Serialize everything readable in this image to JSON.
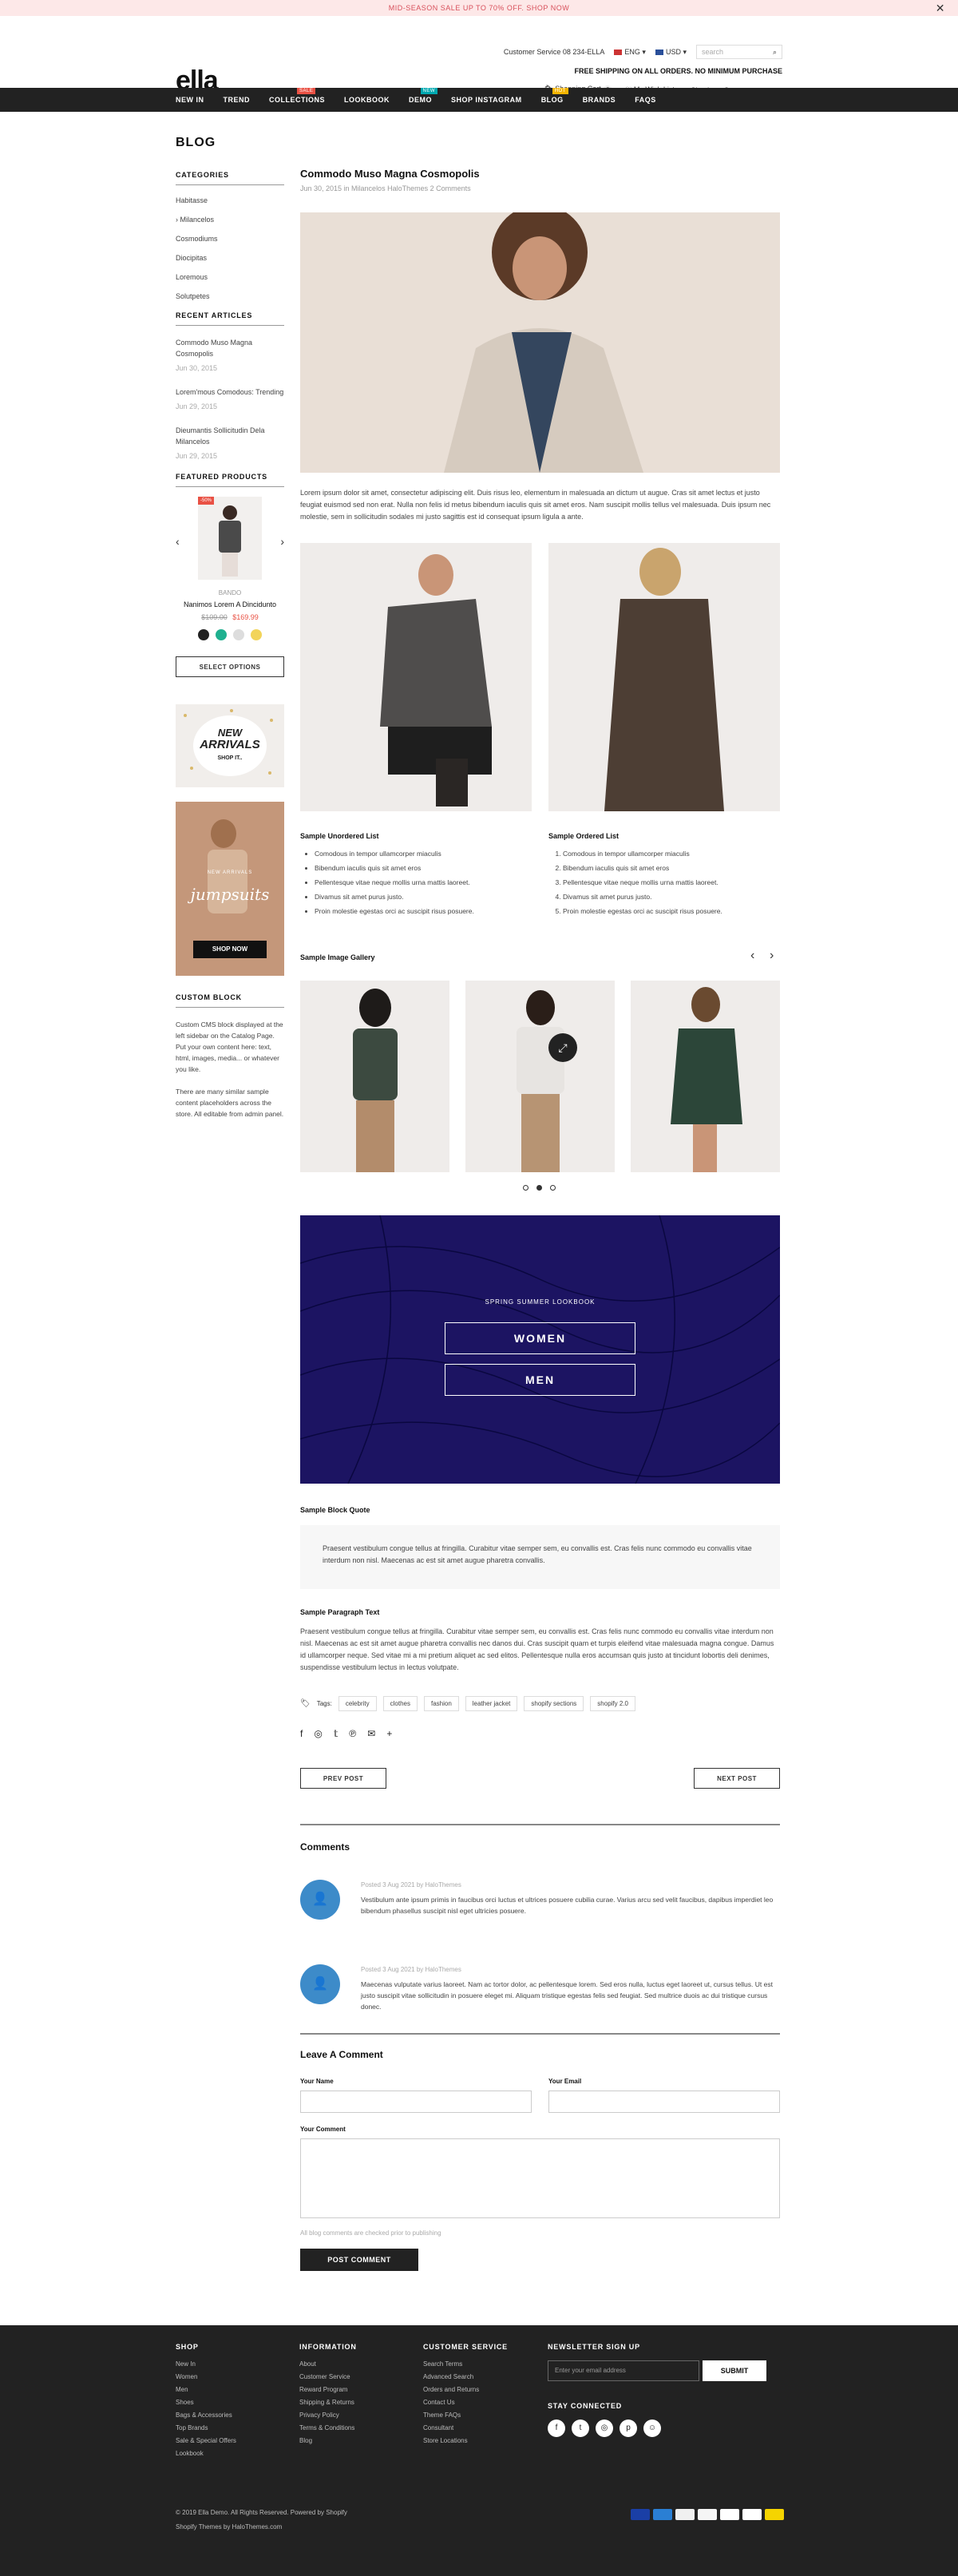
{
  "promo": {
    "text": "MID-SEASON SALE UP TO 70% OFF. SHOP NOW"
  },
  "header": {
    "logo": "ella",
    "customer_service": "Customer Service 08 234-ELLA",
    "lang": "ENG",
    "currency": "USD",
    "search_placeholder": "search",
    "shipping": "FREE SHIPPING ON ALL ORDERS. NO MINIMUM PURCHASE",
    "cart": "Shopping Cart",
    "cart_count": "0",
    "wishlist": "My Wish Lists",
    "signin": "Sign In or Create an account"
  },
  "nav": [
    {
      "label": "NEW IN"
    },
    {
      "label": "TREND"
    },
    {
      "label": "COLLECTIONS",
      "badge": "SALE",
      "color": "#e95144"
    },
    {
      "label": "LOOKBOOK"
    },
    {
      "label": "DEMO",
      "badge": "NEW",
      "color": "#00a8b0"
    },
    {
      "label": "SHOP INSTAGRAM"
    },
    {
      "label": "BLOG",
      "badge": "HOT",
      "color": "#f4b400"
    },
    {
      "label": "BRANDS"
    },
    {
      "label": "FAQS"
    }
  ],
  "sidebar": {
    "heading": "BLOG",
    "categories_title": "CATEGORIES",
    "categories": [
      "Habitasse",
      "Milancelos",
      "Cosmodiums",
      "Diocipitas",
      "Loremous",
      "Solutpetes"
    ],
    "recent_title": "RECENT ARTICLES",
    "recent": [
      {
        "title": "Commodo Muso Magna Cosmopolis",
        "date": "Jun 30, 2015"
      },
      {
        "title": "Lorem'mous Comodous: Trending",
        "date": "Jun 29, 2015"
      },
      {
        "title": "Dieumantis Sollicitudin Dela Milancelos",
        "date": "Jun 29, 2015"
      }
    ],
    "featured_title": "FEATURED PRODUCTS",
    "product": {
      "badge": "-50%",
      "vendor": "BANDO",
      "name": "Nanimos Lorem A Dincidunto",
      "old_price": "$109.00",
      "price": "$169.99",
      "swatches": [
        "#222222",
        "#1fb08f",
        "#dddddd",
        "#f2d45a"
      ],
      "button": "SELECT OPTIONS"
    },
    "banner1": {
      "line1": "NEW",
      "line2": "ARRIVALS",
      "line3": "SHOP IT.."
    },
    "banner2": {
      "small": "NEW ARRIVALS",
      "script": "jumpsuits",
      "button": "SHOP NOW"
    },
    "custom_title": "CUSTOM BLOCK",
    "custom_p1": "Custom CMS block displayed at the left sidebar on the Catalog Page. Put your own content here: text, html, images, media... or whatever you like.",
    "custom_p2": "There are many similar sample content placeholders across the store. All editable from admin panel."
  },
  "post": {
    "title": "Commodo Muso Magna Cosmopolis",
    "meta": "Jun 30, 2015 in Milancelos   HaloThemes   2 Comments",
    "intro": "Lorem ipsum dolor sit amet, consectetur adipiscing elit. Duis risus leo, elementum in malesuada an dictum ut augue. Cras sit amet lectus et justo feugiat euismod sed non erat. Nulla non felis id metus bibendum iaculis quis sit amet eros. Nam suscipit mollis tellus vel malesuada. Duis ipsum nec molestie, sem in sollicitudin sodales mi justo sagittis est id consequat ipsum ligula a ante.",
    "ul_title": "Sample Unordered List",
    "ul": [
      "Comodous in tempor ullamcorper miaculis",
      "Bibendum iaculis quis sit amet eros",
      "Pellentesque vitae neque mollis urna mattis laoreet.",
      "Divamus sit amet purus justo.",
      "Proin molestie egestas orci ac suscipit risus posuere."
    ],
    "ol_title": "Sample Ordered List",
    "ol": [
      "Comodous in tempor ullamcorper miaculis",
      "Bibendum iaculis quis sit amet eros",
      "Pellentesque vitae neque mollis urna mattis laoreet.",
      "Divamus sit amet purus justo.",
      "Proin molestie egestas orci ac suscipit risus posuere."
    ],
    "gallery_title": "Sample Image Gallery",
    "lookbook_small": "SPRING SUMMER LOOKBOOK",
    "lookbook_women": "WOMEN",
    "lookbook_men": "MEN",
    "quote_title": "Sample Block Quote",
    "quote": "Praesent vestibulum congue tellus at fringilla. Curabitur vitae semper sem, eu convallis est. Cras felis nunc commodo eu convallis vitae interdum non nisl. Maecenas ac est sit amet augue pharetra convallis.",
    "ptext_title": "Sample Paragraph Text",
    "ptext": "Praesent vestibulum congue tellus at fringilla. Curabitur vitae semper sem, eu convallis est. Cras felis nunc commodo eu convallis vitae interdum non nisl. Maecenas ac est sit amet augue pharetra convallis nec danos dui. Cras suscipit quam et turpis eleifend vitae malesuada magna congue. Damus id ullamcorper neque. Sed vitae mi a mi pretium aliquet ac sed elitos. Pellentesque nulla eros accumsan quis justo at tincidunt lobortis deli denimes, suspendisse vestibulum lectus in lectus volutpate.",
    "tags_label": "Tags:",
    "tags": [
      "celebrity",
      "clothes",
      "fashion",
      "leather jacket",
      "shopify sections",
      "shopify 2.0"
    ],
    "prev": "PREV POST",
    "next": "NEXT POST"
  },
  "comments": {
    "title": "Comments",
    "items": [
      {
        "meta": "Posted 3 Aug 2021 by HaloThemes",
        "text": "Vestibulum ante ipsum primis in faucibus orci luctus et ultrices posuere cubilia curae. Varius arcu sed velit faucibus, dapibus imperdiet leo bibendum phasellus suscipit nisl eget ultricies posuere."
      },
      {
        "meta": "Posted 3 Aug 2021 by HaloThemes",
        "text": "Maecenas vulputate varius laoreet. Nam ac tortor dolor, ac pellentesque lorem. Sed eros nulla, luctus eget laoreet ut, cursus tellus. Ut est justo suscipit vitae sollicitudin in posuere eleget mi. Aliquam tristique egestas felis sed feugiat. Sed multrice duois ac dui tristique cursus donec."
      }
    ]
  },
  "form": {
    "title": "Leave A Comment",
    "name_label": "Your Name",
    "email_label": "Your Email",
    "comment_label": "Your Comment",
    "note": "All blog comments are checked prior to publishing",
    "submit": "POST COMMENT"
  },
  "footer": {
    "cols": [
      {
        "title": "SHOP",
        "items": [
          "New In",
          "Women",
          "Men",
          "Shoes",
          "Bags & Accessories",
          "Top Brands",
          "Sale & Special Offers",
          "Lookbook"
        ]
      },
      {
        "title": "INFORMATION",
        "items": [
          "About",
          "Customer Service",
          "Reward Program",
          "Shipping & Returns",
          "Privacy Policy",
          "Terms & Conditions",
          "Blog"
        ]
      },
      {
        "title": "CUSTOMER SERVICE",
        "items": [
          "Search Terms",
          "Advanced Search",
          "Orders and Returns",
          "Contact Us",
          "Theme FAQs",
          "Consultant",
          "Store Locations"
        ]
      }
    ],
    "newsletter_title": "NEWSLETTER SIGN UP",
    "newsletter_placeholder": "Enter your email address",
    "submit": "SUBMIT",
    "stay": "STAY CONNECTED",
    "copyright": "© 2019 Ella Demo. All Rights Reserved. Powered by Shopify",
    "credit": "Shopify Themes by HaloThemes.com",
    "payments": [
      "visa",
      "amex",
      "mastercard",
      "discover",
      "paypal",
      "applepay",
      "mastercard-2"
    ]
  }
}
